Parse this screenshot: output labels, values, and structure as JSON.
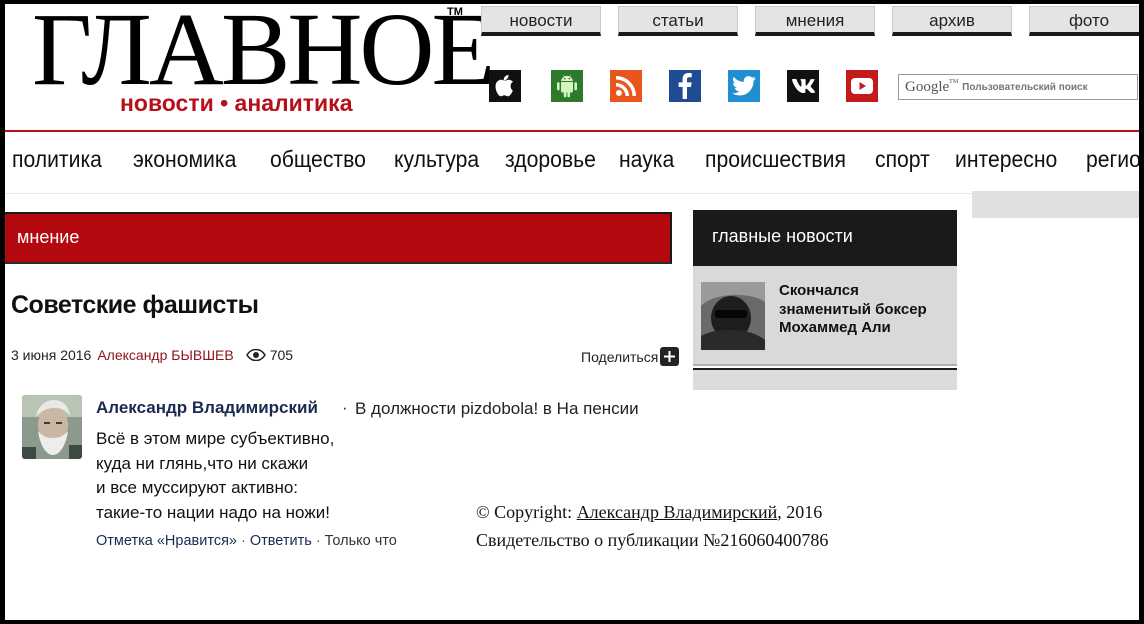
{
  "logo": {
    "title": "ГЛАВНОЕ",
    "tm": "TM",
    "subtitle": "новости • аналитика",
    "brand_color": "#b8101a"
  },
  "top_nav": [
    "новости",
    "статьи",
    "мнения",
    "архив",
    "фото"
  ],
  "social_icons": [
    "apple-icon",
    "android-icon",
    "rss-icon",
    "facebook-icon",
    "twitter-icon",
    "vk-icon",
    "youtube-icon"
  ],
  "search": {
    "logo_text": "Google",
    "tm": "TM",
    "placeholder": "Пользовательский поиск"
  },
  "categories": [
    "политика",
    "экономика",
    "общество",
    "культура",
    "здоровье",
    "наука",
    "происшествия",
    "спорт",
    "интересно",
    "регио"
  ],
  "section": "мнение",
  "article": {
    "title": "Советские фашисты",
    "date": "3 июня 2016",
    "author": "Александр БЫВШЕВ",
    "views": "705",
    "share_label": "Поделиться"
  },
  "comment": {
    "author": "Александр Владимирский",
    "separator": "·",
    "role": "В должности pizdobola! в На пенсии",
    "lines": [
      "Всё в этом мире субъективно,",
      "куда ни глянь,что ни скажи",
      "и все муссируют активно:",
      "такие-то нации надо на ножи!"
    ],
    "actions": {
      "like": "Отметка «Нравится»",
      "reply": "Ответить",
      "time": "Только что"
    }
  },
  "copyright": {
    "prefix": "© Copyright:",
    "author": "Александр Владимирский",
    "year": ", 2016",
    "certificate": "Свидетельство о публикации №216060400786"
  },
  "sidebar": {
    "header": "главные новости",
    "items": [
      {
        "title": "Скончался знаменитый боксер Мохаммед Али"
      }
    ]
  },
  "colors": {
    "accent_red": "#b4080f",
    "dark": "#1a1a1a"
  }
}
